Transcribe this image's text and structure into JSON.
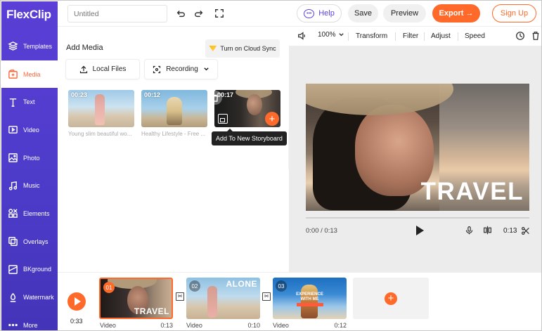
{
  "app": {
    "logo_text": "FlexClip"
  },
  "sidebar": {
    "items": [
      {
        "label": "Templates",
        "icon": "layers-icon"
      },
      {
        "label": "Media",
        "icon": "media-icon"
      },
      {
        "label": "Text",
        "icon": "text-icon"
      },
      {
        "label": "Video",
        "icon": "video-icon"
      },
      {
        "label": "Photo",
        "icon": "photo-icon"
      },
      {
        "label": "Music",
        "icon": "music-icon"
      },
      {
        "label": "Elements",
        "icon": "elements-icon"
      },
      {
        "label": "Overlays",
        "icon": "overlays-icon"
      },
      {
        "label": "BKground",
        "icon": "background-icon"
      },
      {
        "label": "Watermark",
        "icon": "watermark-icon"
      },
      {
        "label": "More",
        "icon": "more-icon"
      }
    ],
    "active": "Media",
    "active_color": "#ff6a3d"
  },
  "topbar": {
    "title_placeholder": "Untitled",
    "help_label": "Help",
    "save_label": "Save",
    "preview_label": "Preview",
    "export_label": "Export →",
    "signup_label": "Sign Up",
    "accent_color": "#ff6a2a"
  },
  "media_panel": {
    "title": "Add Media",
    "cloud_sync_label": "Turn on Cloud Sync",
    "local_files_label": "Local Files",
    "recording_label": "Recording",
    "thumbs": [
      {
        "duration": "00:23",
        "caption": "Young slim beautiful wo..."
      },
      {
        "duration": "00:12",
        "caption": "Healthy Lifestyle - Free ..."
      },
      {
        "duration": "00:17",
        "caption": ""
      }
    ],
    "tooltip": "Add To New Storyboard"
  },
  "preview": {
    "zoom": "100%",
    "tools": [
      "Transform",
      "Filter",
      "Adjust",
      "Speed"
    ],
    "overlay_text": "TRAVEL",
    "time_current": "0:00 / 0:13",
    "time_right": "0:13"
  },
  "storyboard": {
    "total_time": "0:33",
    "clips": [
      {
        "num": "01",
        "type": "Video",
        "duration": "0:13",
        "overlay": "TRAVEL"
      },
      {
        "num": "02",
        "type": "Video",
        "duration": "0:10",
        "overlay": "ALONE"
      },
      {
        "num": "03",
        "type": "Video",
        "duration": "0:12",
        "overlay": "EXPERIENCE WITH ME"
      }
    ]
  }
}
